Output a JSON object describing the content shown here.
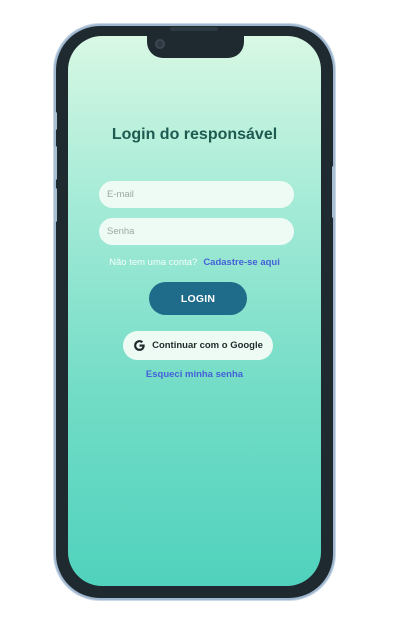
{
  "screen": {
    "title": "Login do responsável"
  },
  "form": {
    "email_placeholder": "E-mail",
    "password_placeholder": "Senha",
    "signup_question": "Não tem uma conta?",
    "signup_link": "Cadastre-se aqui",
    "login_label": "LOGIN",
    "google_label": "Continuar com o Google",
    "forgot_label": "Esqueci minha senha"
  },
  "icons": {
    "google": "google-icon",
    "camera": "camera-icon"
  },
  "colors": {
    "title": "#1d5a4f",
    "link": "#4560d8",
    "login_button": "#1f6b8a",
    "gradient_top": "#d8f8e4",
    "gradient_bottom": "#50d2bd",
    "frame": "#1f2a30"
  }
}
